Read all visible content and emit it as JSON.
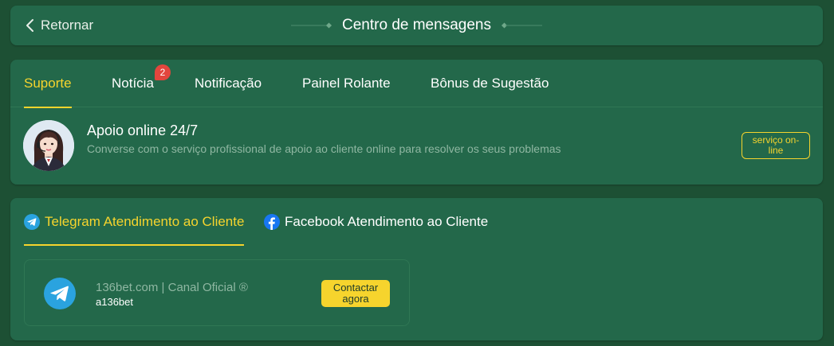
{
  "header": {
    "back_label": "Retornar",
    "title": "Centro de mensagens"
  },
  "support_tabs": [
    {
      "label": "Suporte",
      "active": true
    },
    {
      "label": "Notícia",
      "badge": "2"
    },
    {
      "label": "Notificação"
    },
    {
      "label": "Painel Rolante"
    },
    {
      "label": "Bônus de Sugestão"
    }
  ],
  "agent": {
    "title": "Apoio online 24/7",
    "description": "Converse com o serviço profissional de apoio ao cliente online para resolver os seus problemas",
    "button_label": "serviço on-line"
  },
  "channel_tabs": [
    {
      "label": "Telegram Atendimento ao Cliente",
      "icon": "telegram-icon",
      "active": true
    },
    {
      "label": "Facebook Atendimento ao Cliente",
      "icon": "facebook-icon"
    }
  ],
  "channel": {
    "name": "136bet.com | Canal Oficial ®",
    "handle": "a136bet",
    "button_label": "Contactar agora"
  },
  "colors": {
    "background": "#1d5034",
    "card": "#23684a",
    "accent": "#f6d42d",
    "muted_text": "#8fb7a2",
    "badge": "#e2463d",
    "telegram": "#2aa3df",
    "facebook": "#1877f2"
  }
}
